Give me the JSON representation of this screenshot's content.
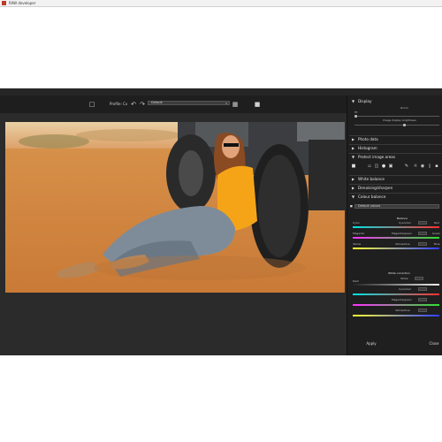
{
  "window": {
    "title": "RAW developer"
  },
  "toolbar": {
    "doc_icon": "document-icon",
    "profile_label": "Profile: Cx",
    "undo_icon": "undo-icon",
    "redo_icon": "redo-icon",
    "preset_value": "Default",
    "settings_icon": "settings-icon",
    "export_icon": "camera-icon"
  },
  "sidebar": {
    "sections": [
      {
        "label": "Display",
        "state": "expanded"
      },
      {
        "label": "Photo data",
        "state": "collapsed"
      },
      {
        "label": "Histogram",
        "state": "collapsed"
      },
      {
        "label": "Protect image areas",
        "state": "expanded"
      },
      {
        "label": "White balance",
        "state": "collapsed"
      },
      {
        "label": "Denoising/sharpen",
        "state": "collapsed"
      },
      {
        "label": "Colour balance",
        "state": "expanded"
      }
    ],
    "display": {
      "zoom_label": "Zoom",
      "zoom_value": "Fit",
      "display_label": "Image display brightness"
    },
    "colour_balance": {
      "preset_value": "Default values",
      "balance_label": "Balance",
      "white_correction_label": "White correction",
      "rows": [
        {
          "left": "Cyan",
          "right": "Red",
          "spin_label": "Cyan/red"
        },
        {
          "left": "Magenta",
          "right": "Green",
          "spin_label": "Magenta/green"
        },
        {
          "left": "Yellow",
          "right": "Blue",
          "spin_label": "Yellow/blue"
        }
      ],
      "white_rows": [
        {
          "left": "Dark",
          "spin_label": "Strike"
        },
        {
          "left": "",
          "spin_label": "Cyan/red"
        },
        {
          "left": "",
          "spin_label": "Magenta/green"
        },
        {
          "left": "",
          "spin_label": "Yellow/blue"
        }
      ]
    },
    "buttons": {
      "apply": "Apply",
      "close": "Close"
    }
  },
  "colors": {
    "app_bg": "#262626",
    "panel_bg": "#1f1f1f",
    "accent": "#c0392b"
  }
}
